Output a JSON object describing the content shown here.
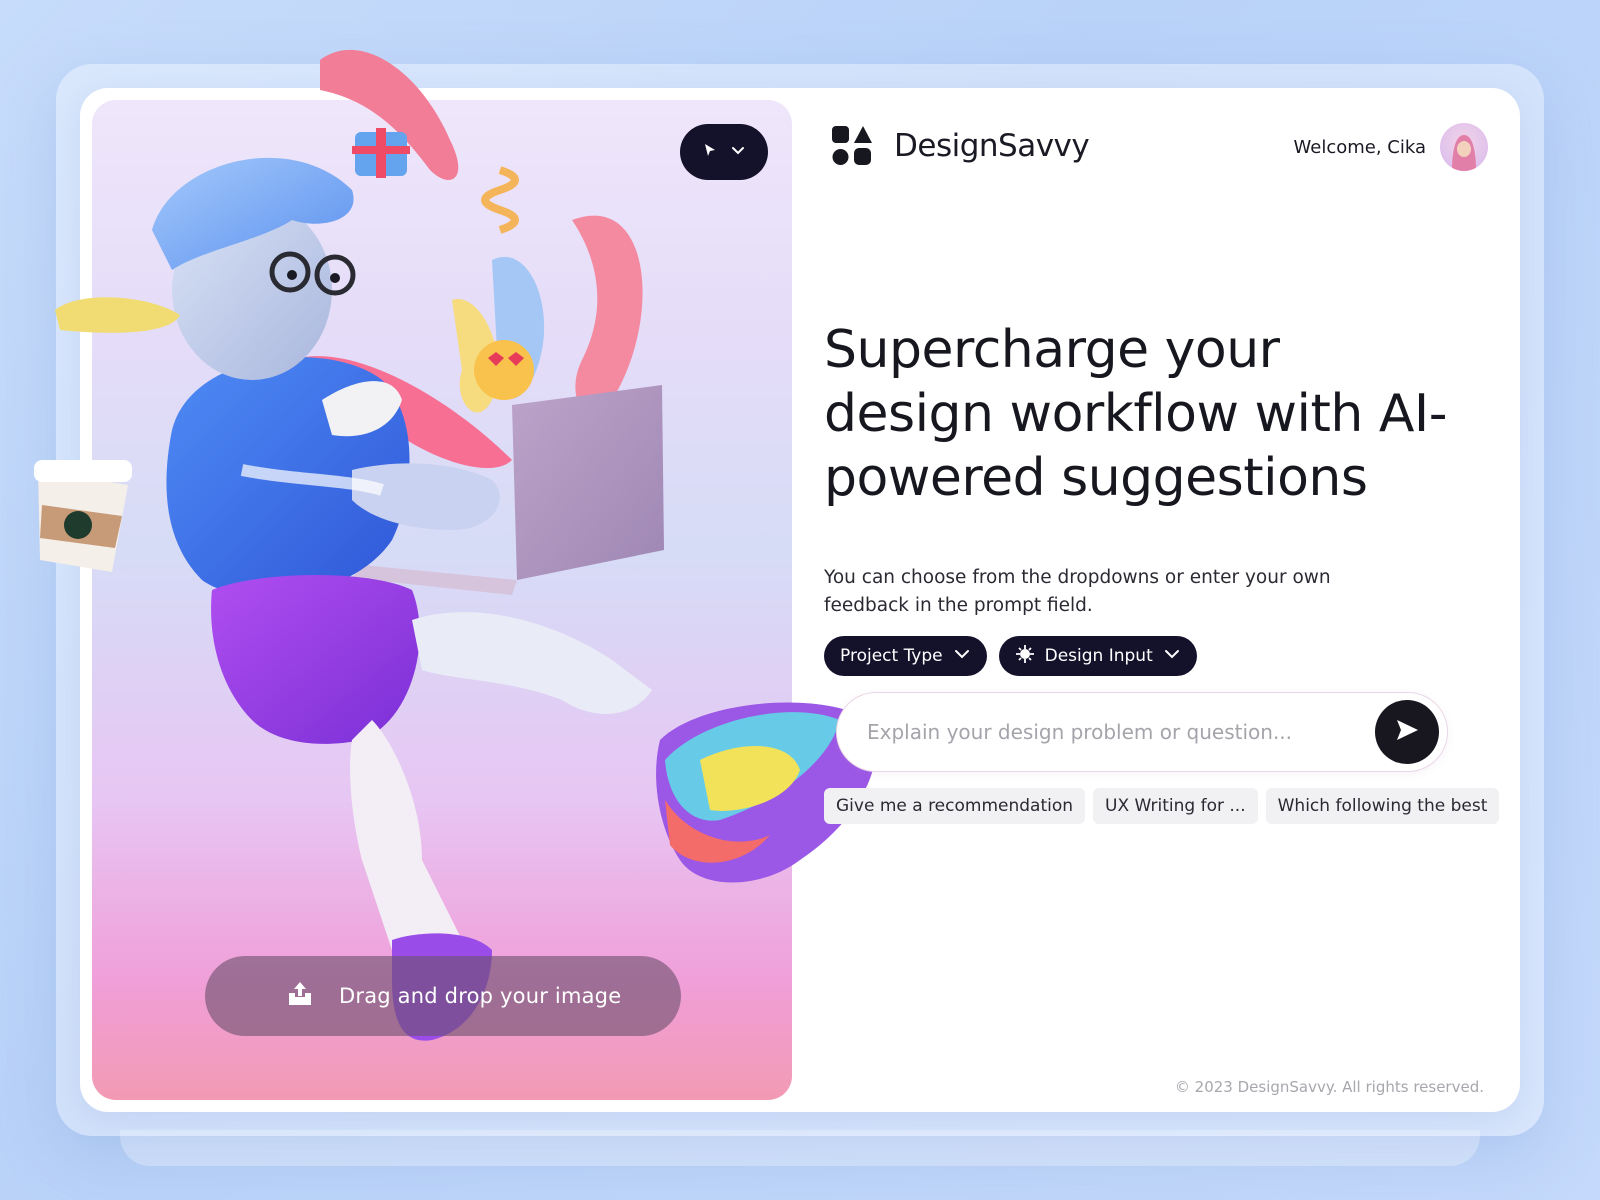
{
  "brand": {
    "name": "DesignSavvy",
    "logo_icon": "grid-shapes-logo-icon"
  },
  "user": {
    "welcome": "Welcome, Cika",
    "avatar_icon": "avatar-icon"
  },
  "hero": {
    "mode_button_icon": "cursor-icon",
    "mode_button_chevron": "chevron-down-icon",
    "upload_label": "Drag and drop your image",
    "upload_icon": "upload-icon"
  },
  "main": {
    "headline": "Supercharge your design workflow with AI-powered suggestions",
    "subtitle": "You can choose from the dropdowns or enter your own feedback in the prompt field.",
    "dropdowns": [
      {
        "label": "Project Type",
        "icon": ""
      },
      {
        "label": "Design Input",
        "icon": "sparkle-icon"
      }
    ],
    "prompt": {
      "placeholder": "Explain your design problem or question...",
      "value": ""
    },
    "send_icon": "send-icon",
    "suggestions": [
      "Give me a recommendation",
      "UX Writing for ...",
      "Which following the best"
    ]
  },
  "footer": {
    "copyright": "© 2023 DesignSavvy. All rights reserved."
  },
  "colors": {
    "background": "#c7dcfb",
    "dark": "#14112b",
    "text": "#17171f",
    "muted": "#a7a7ae"
  }
}
